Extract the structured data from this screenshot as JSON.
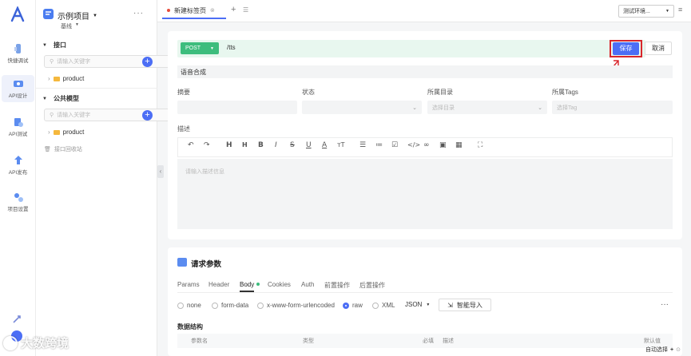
{
  "rail": {
    "items": [
      {
        "label": "快捷调试",
        "icon": "quick-debug-icon"
      },
      {
        "label": "API设计",
        "icon": "api-design-icon"
      },
      {
        "label": "API测试",
        "icon": "api-test-icon"
      },
      {
        "label": "API发布",
        "icon": "api-publish-icon"
      },
      {
        "label": "项目设置",
        "icon": "project-settings-icon"
      }
    ]
  },
  "sidebar": {
    "project_name": "示例项目",
    "branch": "基线",
    "section_api": "接口",
    "search_placeholder_1": "请输入关键字",
    "folder_1": "product",
    "section_models": "公共模型",
    "search_placeholder_2": "请输入关键字",
    "folder_2": "product",
    "recycle": "接口回收站"
  },
  "tabs": {
    "active_tab": "新建标签页",
    "env_select": "测试环境..."
  },
  "request": {
    "method": "POST",
    "url": "/tts",
    "save_label": "保存",
    "cancel_label": "取消",
    "name": "语音合成"
  },
  "meta": {
    "summary_label": "摘要",
    "status_label": "状态",
    "dir_label": "所属目录",
    "dir_placeholder": "选择目录",
    "tags_label": "所属Tags",
    "tags_placeholder": "选择Tag",
    "desc_label": "描述",
    "desc_placeholder": "请输入描述信息"
  },
  "params": {
    "title": "请求参数",
    "tabs": [
      "Params",
      "Header",
      "Body",
      "Cookies",
      "Auth",
      "前置操作",
      "后置操作"
    ],
    "body_types": [
      "none",
      "form-data",
      "x-www-form-urlencoded",
      "raw",
      "XML"
    ],
    "format": "JSON",
    "smart_import": "智能导入",
    "structure_label": "数据结构",
    "columns": [
      "参数名",
      "类型",
      "必填",
      "描述",
      "默认值"
    ]
  },
  "footer": {
    "auto_select": "自动选择"
  },
  "watermark": "大数跨境"
}
